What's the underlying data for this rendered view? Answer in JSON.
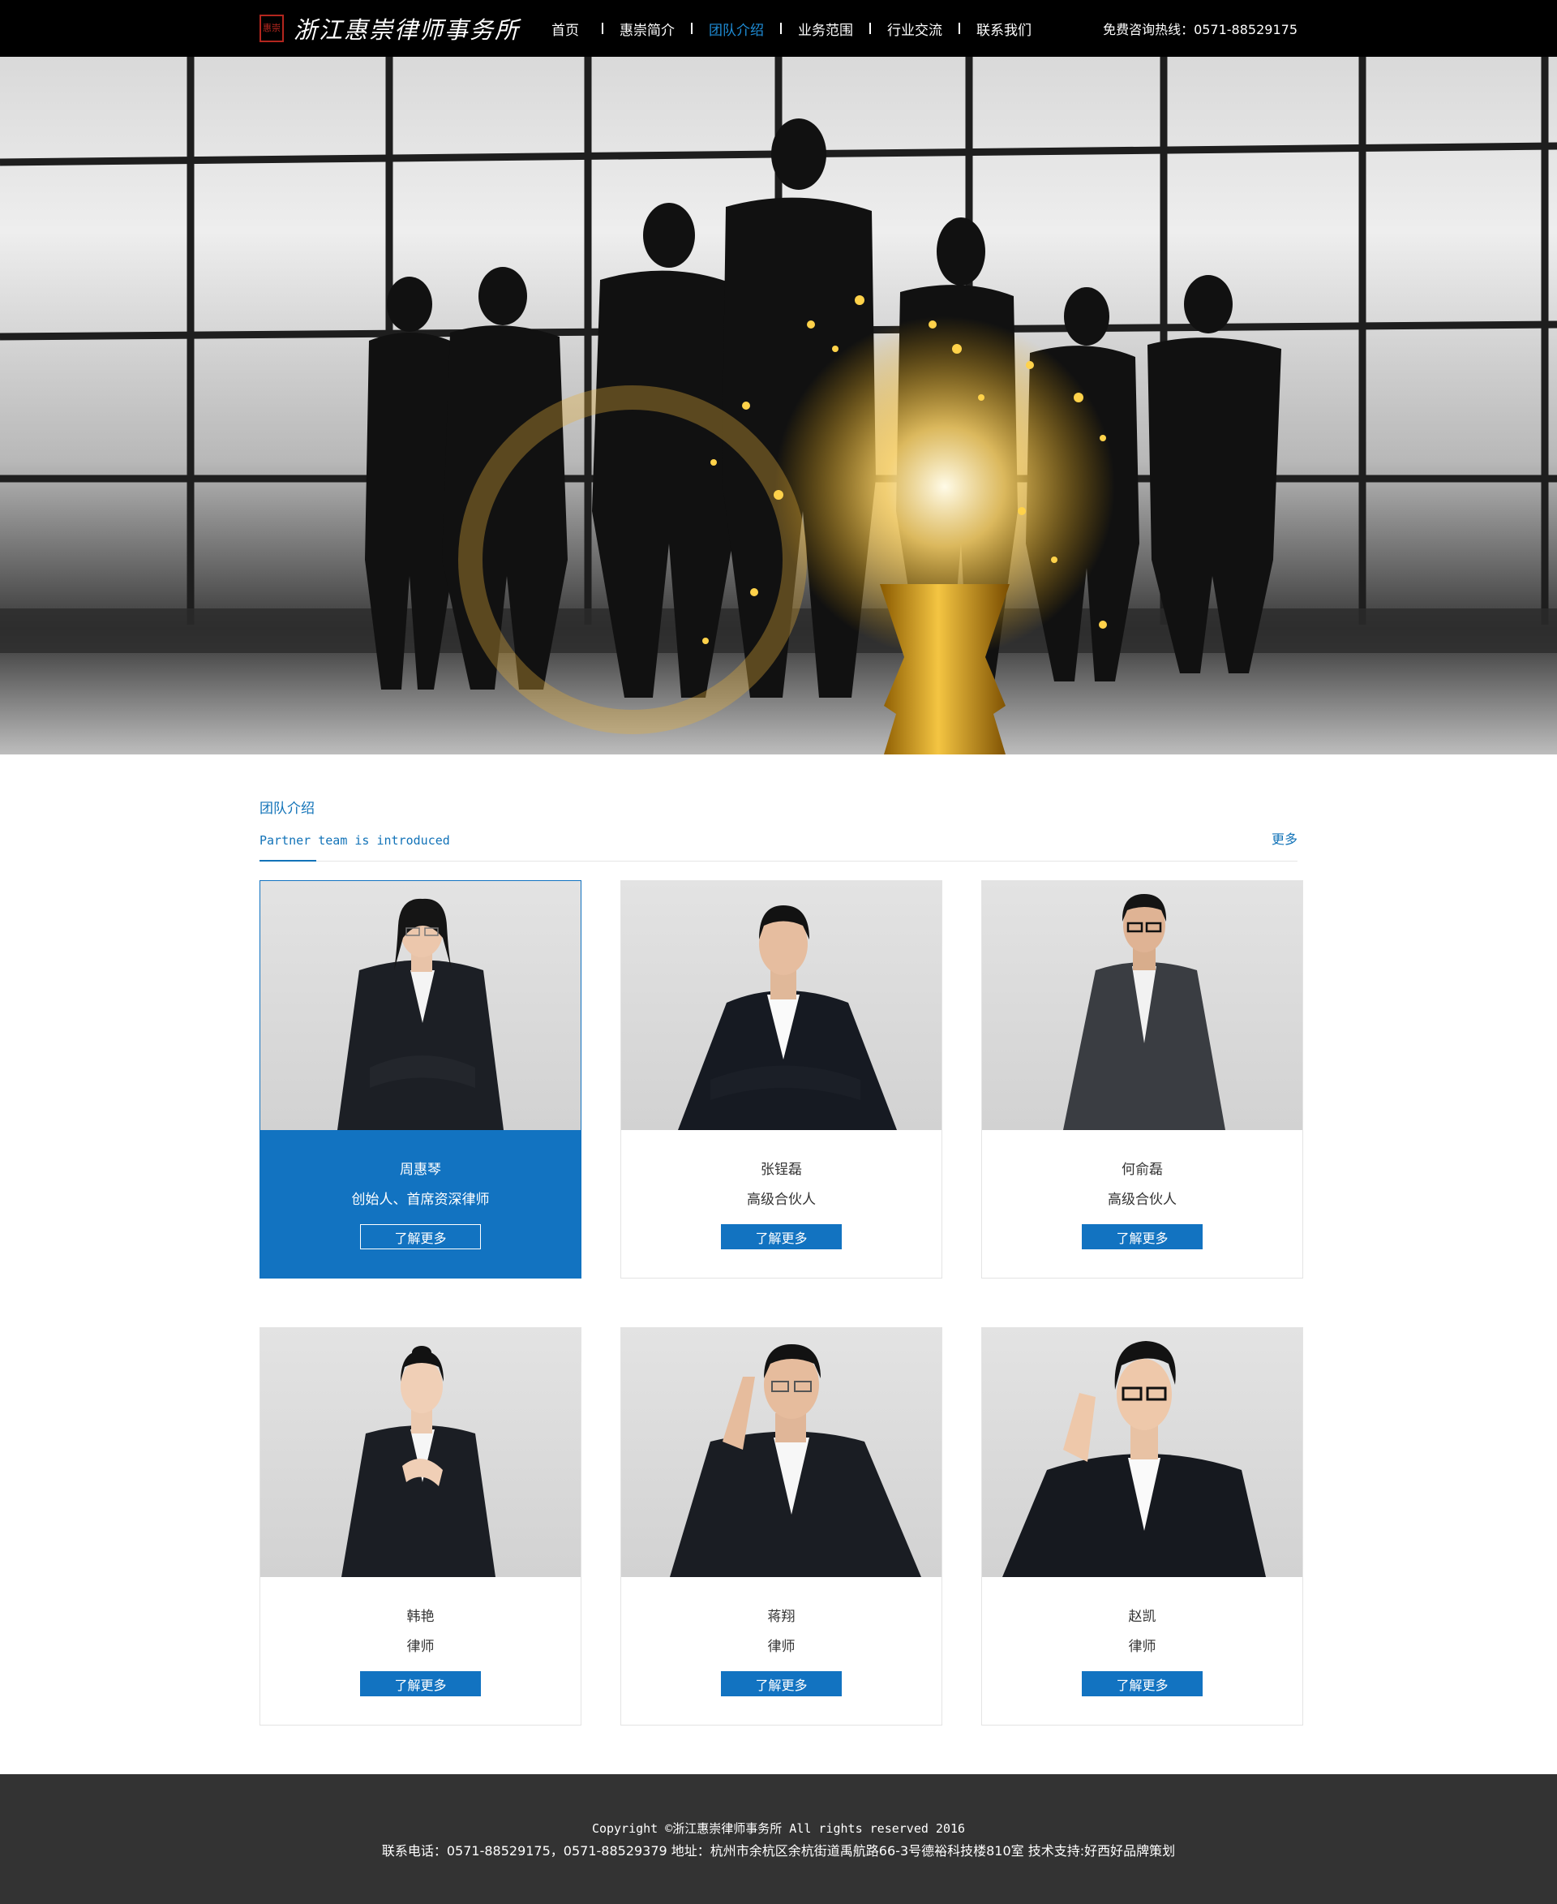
{
  "header": {
    "logo_seal": "惠崇",
    "logo_text": "浙江惠崇律师事务所",
    "nav": [
      {
        "label": "首页",
        "active": false
      },
      {
        "label": "惠崇简介",
        "active": false
      },
      {
        "label": "团队介绍",
        "active": true
      },
      {
        "label": "业务范围",
        "active": false
      },
      {
        "label": "行业交流",
        "active": false
      },
      {
        "label": "联系我们",
        "active": false
      }
    ],
    "hotline": "免费咨询热线：0571-88529175"
  },
  "colors": {
    "accent": "#1273c1",
    "nav_active": "#1f8ed8",
    "header_bg": "#000000",
    "footer_bg": "#333333"
  },
  "team": {
    "title": "团队介绍",
    "subtitle": "Partner team is introduced",
    "more": "更多",
    "button_label": "了解更多",
    "members": [
      {
        "name": "周惠琴",
        "role": "创始人、首席资深律师",
        "highlighted": true
      },
      {
        "name": "张锃磊",
        "role": "高级合伙人",
        "highlighted": false
      },
      {
        "name": "何俞磊",
        "role": "高级合伙人",
        "highlighted": false
      },
      {
        "name": "韩艳",
        "role": "律师",
        "highlighted": false
      },
      {
        "name": "蒋翔",
        "role": "律师",
        "highlighted": false
      },
      {
        "name": "赵凯",
        "role": "律师",
        "highlighted": false
      }
    ]
  },
  "footer": {
    "copyright": "Copyright ©浙江惠崇律师事务所 All rights reserved 2016",
    "contact": "联系电话：0571-88529175，0571-88529379 地址：杭州市余杭区余杭街道禹航路66-3号德裕科技楼810室 技术支持:好西好品牌策划"
  }
}
